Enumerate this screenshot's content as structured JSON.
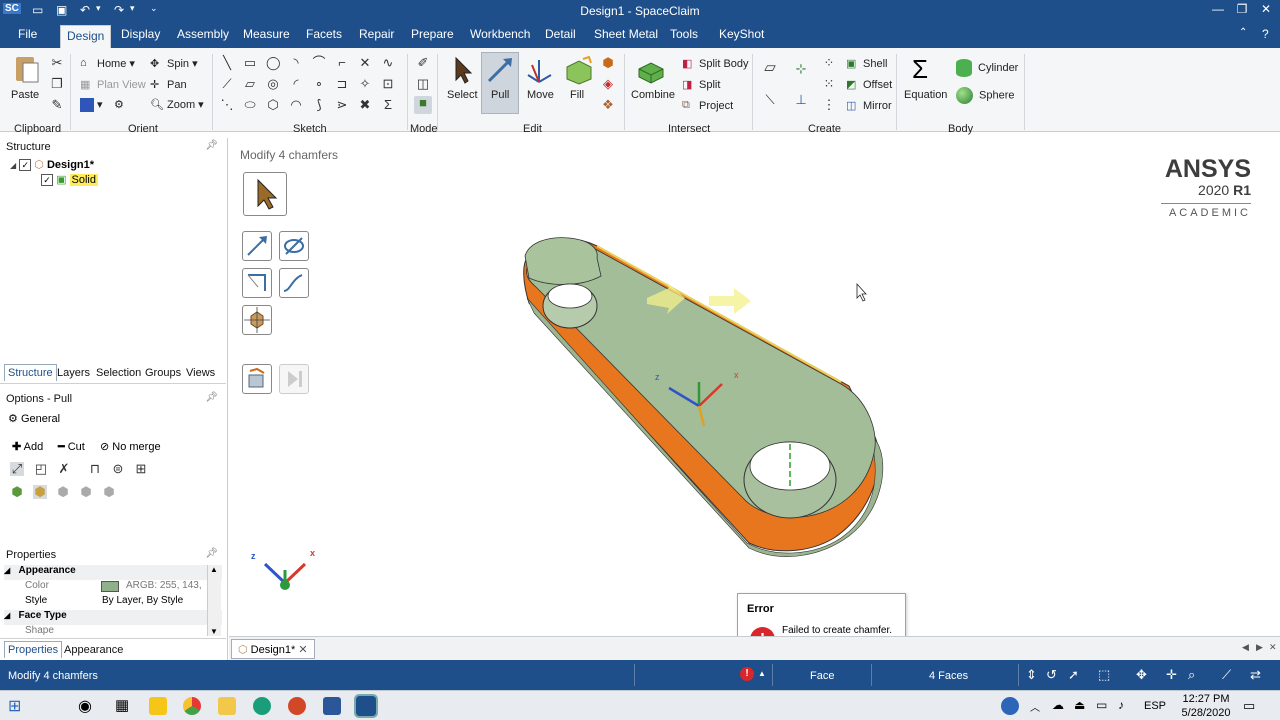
{
  "window": {
    "title": "Design1 - SpaceClaim",
    "app_badge": "SC"
  },
  "menu": {
    "tabs": [
      "File",
      "Design",
      "Display",
      "Assembly",
      "Measure",
      "Facets",
      "Repair",
      "Prepare",
      "Workbench",
      "Detail",
      "Sheet Metal",
      "Tools",
      "KeyShot"
    ],
    "active": "Design"
  },
  "ribbon": {
    "clipboard": {
      "paste": "Paste",
      "group": "Clipboard"
    },
    "orient": {
      "home": "Home",
      "spin": "Spin",
      "plan_view": "Plan View",
      "pan": "Pan",
      "zoom": "Zoom",
      "group": "Orient"
    },
    "sketch": {
      "group": "Sketch"
    },
    "mode": {
      "group": "Mode"
    },
    "edit": {
      "select": "Select",
      "pull": "Pull",
      "move": "Move",
      "fill": "Fill",
      "group": "Edit"
    },
    "intersect": {
      "combine": "Combine",
      "split_body": "Split Body",
      "split": "Split",
      "project": "Project",
      "group": "Intersect"
    },
    "create": {
      "shell": "Shell",
      "offset": "Offset",
      "mirror": "Mirror",
      "group": "Create"
    },
    "body": {
      "equation": "Equation",
      "cylinder": "Cylinder",
      "sphere": "Sphere",
      "group": "Body"
    }
  },
  "structure": {
    "title": "Structure",
    "root": "Design1*",
    "child": "Solid"
  },
  "panel_tabs": [
    "Structure",
    "Layers",
    "Selection",
    "Groups",
    "Views"
  ],
  "options": {
    "title": "Options - Pull",
    "general": "General",
    "add": "Add",
    "cut": "Cut",
    "no_merge": "No merge"
  },
  "properties": {
    "title": "Properties",
    "appearance": "Appearance",
    "color_label": "Color",
    "color_value": "ARGB: 255, 143,",
    "style_label": "Style",
    "style_value": "By Layer, By Style",
    "face_type": "Face Type",
    "shape_label": "Shape"
  },
  "bottom_tabs": [
    "Properties",
    "Appearance"
  ],
  "canvas": {
    "hint": "Modify 4 chamfers",
    "brand": "ANSYS",
    "version": "2020",
    "release": "R1",
    "edition": "ACADEMIC"
  },
  "doc_tab": "Design1*",
  "error": {
    "title": "Error",
    "message": "Failed to create chamfer."
  },
  "status": {
    "text": "Modify 4 chamfers",
    "face": "Face",
    "count": "4 Faces"
  },
  "taskbar": {
    "lang": "ESP",
    "time": "12:27 PM",
    "date": "5/28/2020"
  },
  "colors": {
    "brand_blue": "#1e4f8a",
    "part_green": "#8fb08a",
    "chamfer_orange": "#e8761e",
    "error_red": "#d9262b"
  }
}
